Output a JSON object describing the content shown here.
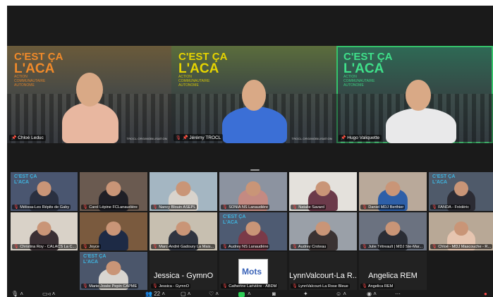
{
  "brand": {
    "line1": "C'EST ÇA",
    "line2": "L'ACA",
    "small": "ACTION COMMUNAUTAIRE AUTONOME"
  },
  "speakers": [
    {
      "name": "Chloé Leduc",
      "tag": "TROCL.ORG/MOBILISATION"
    },
    {
      "name": "Jérémy TROCL",
      "tag": "TROCL.ORG/MOBILISATION"
    },
    {
      "name": "Hugo Valiquette",
      "tag": ""
    }
  ],
  "gallery": [
    {
      "name": "Mélissa-Les Répits de Gaby",
      "aca": true
    },
    {
      "name": "Carol Lépine FCLanaudière",
      "aca": false
    },
    {
      "name": "Nancy Blouin ASEPL",
      "aca": false
    },
    {
      "name": "SONIA NS Lanaudière",
      "aca": false
    },
    {
      "name": "Natalie Savard",
      "aca": false
    },
    {
      "name": "Daniel MDJ Berthier",
      "aca": false
    },
    {
      "name": "FANDA - Frédéric",
      "aca": true
    },
    {
      "name": "Christina Roy - CALACS La C...",
      "aca": false
    },
    {
      "name": "Joyce",
      "aca": false
    },
    {
      "name": "Marc-André Gadoury La Mais...",
      "aca": false
    },
    {
      "name": "Audrey NS Lanaudière",
      "aca": true
    },
    {
      "name": "Audrey Croteau",
      "aca": false
    },
    {
      "name": "Julie Tétreault | MDJ Ste-Mar...",
      "aca": false
    },
    {
      "name": "Chloé - MDJ Mascouche - R...",
      "aca": false
    },
    {
      "name": "Marie-Josée Pepin CAPME",
      "aca": true
    }
  ],
  "name_cards": [
    {
      "display": "Jessica - GymnO",
      "name": "Jessica - GymnO"
    },
    {
      "display": "",
      "name": "Catherine Larivière - ABDM",
      "logo": "Mots"
    },
    {
      "display": "LynnValcourt-La R...",
      "name": "LynnValcourt-La Rose Bleue"
    },
    {
      "display": "Angelica REM",
      "name": "Angelica REM"
    }
  ],
  "toolbar": {
    "participants_count": "22"
  }
}
